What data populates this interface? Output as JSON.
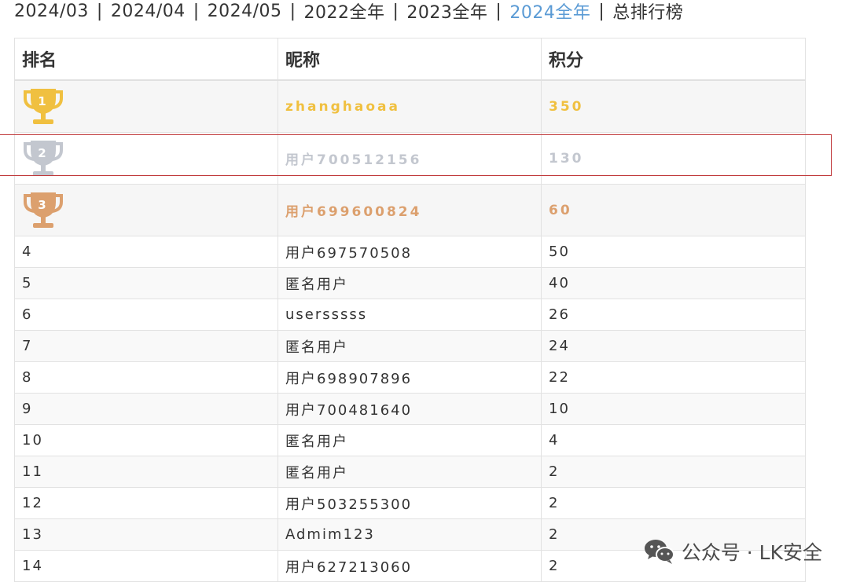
{
  "period_nav": {
    "items": [
      {
        "label": "2024/03",
        "active": false
      },
      {
        "label": "2024/04",
        "active": false
      },
      {
        "label": "2024/05",
        "active": false
      },
      {
        "label": "2022全年",
        "active": false
      },
      {
        "label": "2023全年",
        "active": false
      },
      {
        "label": "2024全年",
        "active": true
      },
      {
        "label": "总排行榜",
        "active": false
      }
    ],
    "separator": "|"
  },
  "table": {
    "headers": [
      "排名",
      "昵称",
      "积分"
    ],
    "rows": [
      {
        "rank": "1",
        "nickname": "zhanghaoaa",
        "score": "350",
        "trophy": "gold-trophy-icon"
      },
      {
        "rank": "2",
        "nickname": "用户700512156",
        "score": "130",
        "trophy": "silver-trophy-icon"
      },
      {
        "rank": "3",
        "nickname": "用户699600824",
        "score": "60",
        "trophy": "bronze-trophy-icon"
      },
      {
        "rank": "4",
        "nickname": "用户697570508",
        "score": "50"
      },
      {
        "rank": "5",
        "nickname": "匿名用户",
        "score": "40"
      },
      {
        "rank": "6",
        "nickname": "usersssss",
        "score": "26"
      },
      {
        "rank": "7",
        "nickname": "匿名用户",
        "score": "24"
      },
      {
        "rank": "8",
        "nickname": "用户698907896",
        "score": "22"
      },
      {
        "rank": "9",
        "nickname": "用户700481640",
        "score": "10"
      },
      {
        "rank": "10",
        "nickname": "匿名用户",
        "score": "4"
      },
      {
        "rank": "11",
        "nickname": "匿名用户",
        "score": "2"
      },
      {
        "rank": "12",
        "nickname": "用户503255300",
        "score": "2"
      },
      {
        "rank": "13",
        "nickname": "Admim123",
        "score": "2"
      },
      {
        "rank": "14",
        "nickname": "用户627213060",
        "score": "2"
      }
    ]
  },
  "colors": {
    "gold": "#f0c040",
    "silver": "#c3c7cf",
    "bronze": "#dca06e",
    "active_link": "#5b9bd5",
    "highlight_border": "#c0393b"
  },
  "watermark": {
    "icon": "wechat-icon",
    "text": "公众号 · LK安全"
  }
}
